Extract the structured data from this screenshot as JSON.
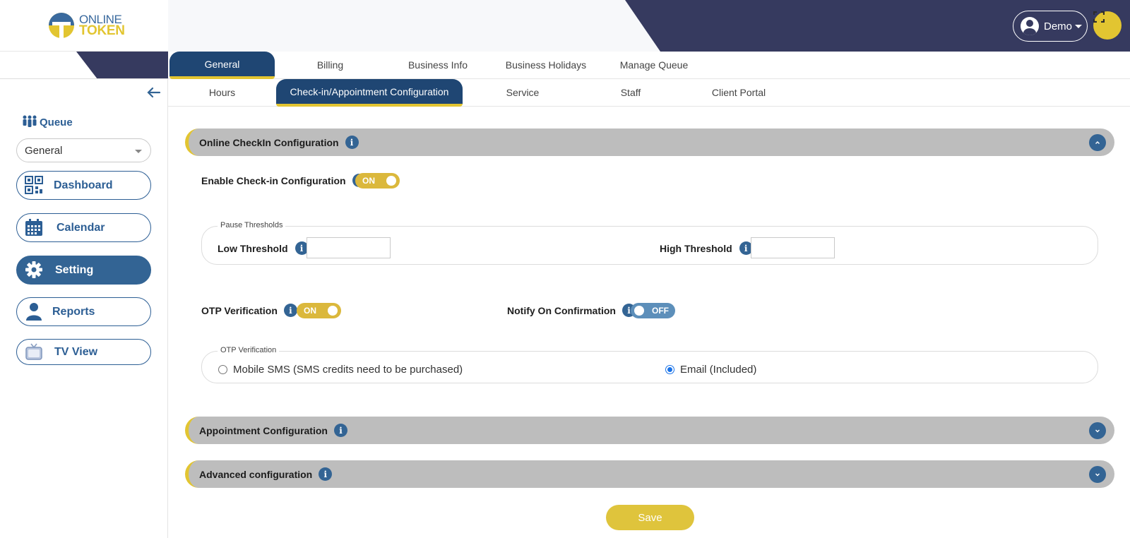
{
  "brand": {
    "line1": "ONLINE",
    "line2": "TOKEN"
  },
  "header": {
    "user_label": "Demo"
  },
  "sidebar": {
    "queue_label": "Queue",
    "queue_select_value": "General",
    "items": [
      {
        "label": "Dashboard"
      },
      {
        "label": "Calendar"
      },
      {
        "label": "Setting"
      },
      {
        "label": "Reports"
      },
      {
        "label": "TV View"
      }
    ]
  },
  "tabs_primary": [
    "General",
    "Billing",
    "Business Info",
    "Business Holidays",
    "Manage Queue"
  ],
  "tabs_secondary": [
    "Hours",
    "Check-in/Appointment Configuration",
    "Service",
    "Staff",
    "Client Portal"
  ],
  "sections": {
    "online_checkin": {
      "title": "Online CheckIn Configuration",
      "enable_label": "Enable Check-in Configuration",
      "enable_state": "ON",
      "pause_legend": "Pause Thresholds",
      "low_label": "Low Threshold",
      "low_value": "",
      "high_label": "High Threshold",
      "high_value": "",
      "otp_label": "OTP Verification",
      "otp_state": "ON",
      "notify_label": "Notify On Confirmation",
      "notify_state": "OFF",
      "otp_legend": "OTP Verification",
      "sms_option": "Mobile SMS (SMS credits need to be purchased)",
      "email_option": "Email (Included)"
    },
    "appointment": {
      "title": "Appointment Configuration"
    },
    "advanced": {
      "title": "Advanced configuration"
    }
  },
  "actions": {
    "save_label": "Save"
  },
  "colors": {
    "navy": "#363a5f",
    "primary_blue": "#336494",
    "accent_yellow": "#e2c531",
    "section_gray": "#bdbdbd"
  }
}
